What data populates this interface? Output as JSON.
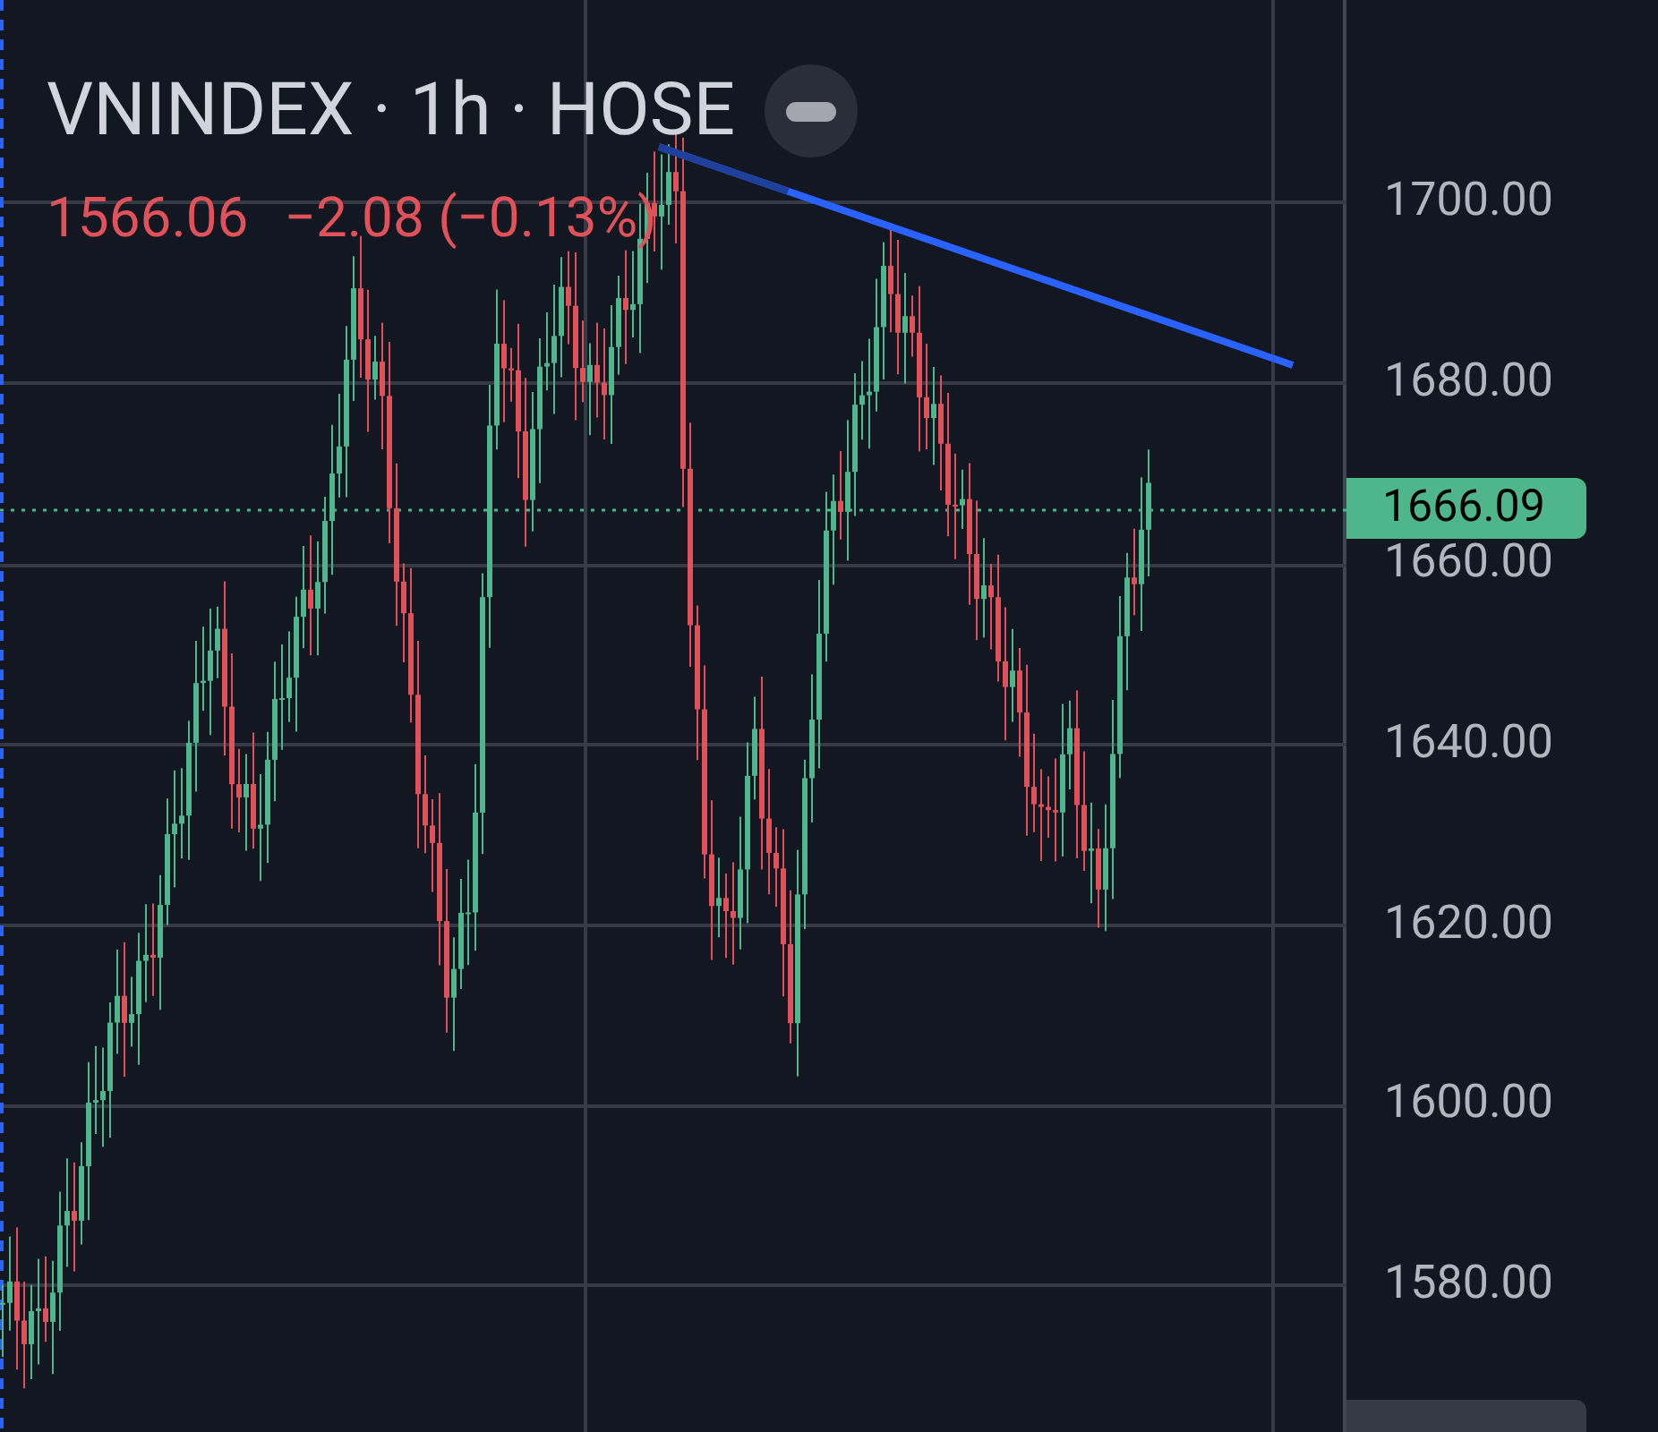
{
  "legend": {
    "title": "VNINDEX · 1h · HOSE",
    "price": "1566.06",
    "change": "−2.08 (−0.13%)"
  },
  "price_axis": {
    "labels": [
      "1700.00",
      "1680.00",
      "1660.00",
      "1640.00",
      "1620.00",
      "1600.00",
      "1580.00"
    ],
    "last_price": "1666.09"
  }
}
